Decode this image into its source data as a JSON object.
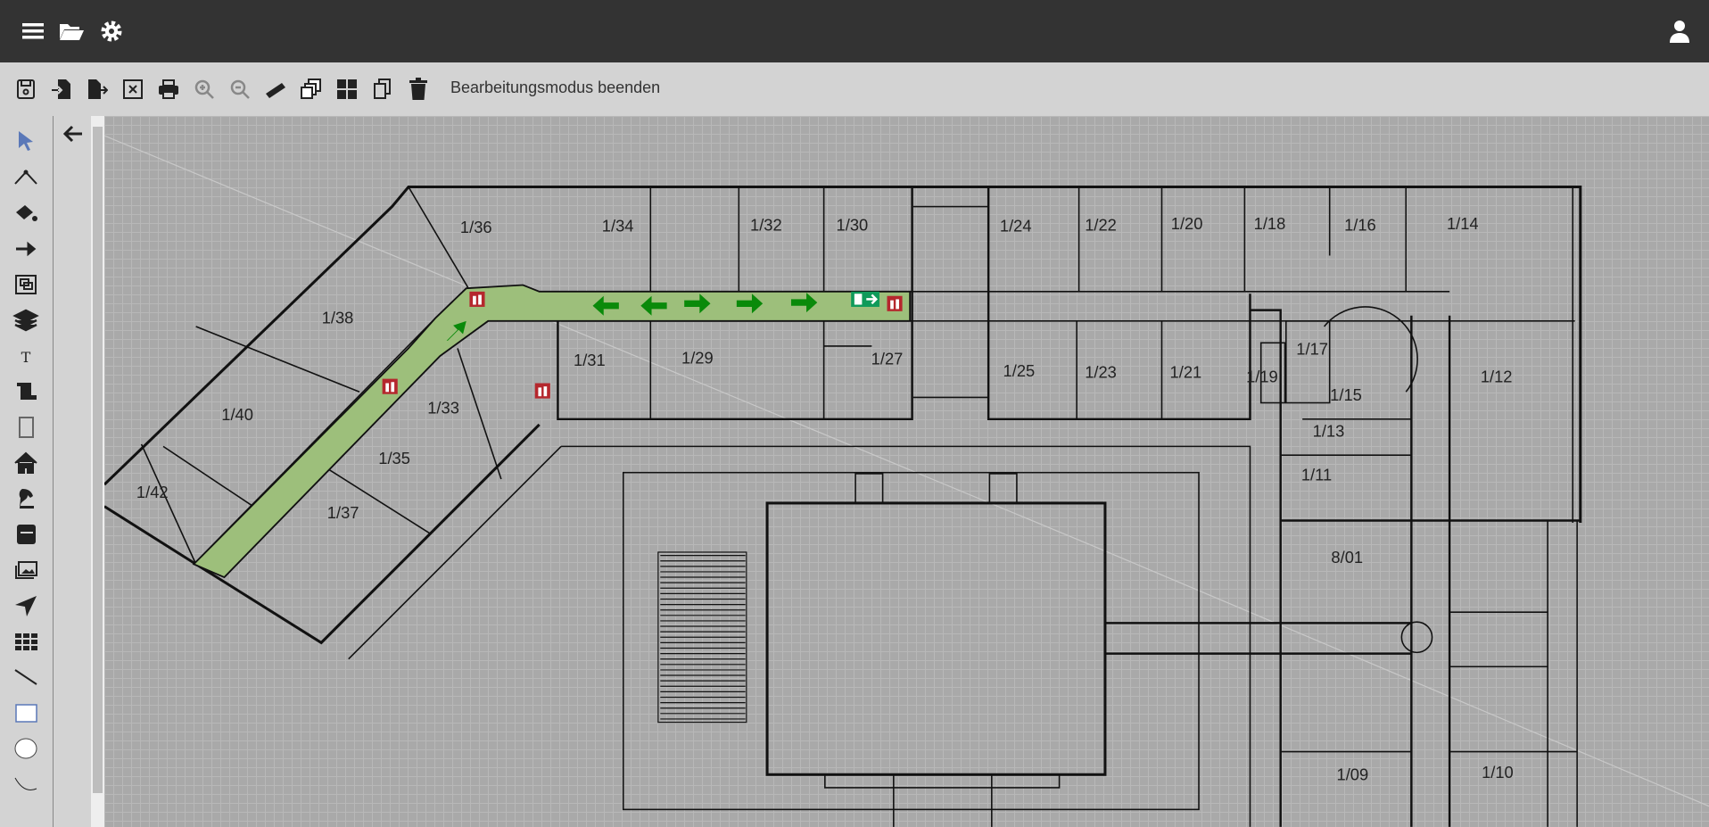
{
  "topbar": {
    "icons": [
      "menu-icon",
      "folder-open-icon",
      "gear-icon",
      "user-icon"
    ]
  },
  "toolbar": {
    "icons": [
      "save-icon",
      "import-icon",
      "export-icon",
      "close-file-icon",
      "print-icon",
      "zoom-in-icon",
      "zoom-out-icon",
      "ruler-icon",
      "clone-icon",
      "grid-icon",
      "copy-icon",
      "trash-icon"
    ],
    "exit_edit_label": "Bearbeitungsmodus beenden"
  },
  "tools": [
    "pointer-icon",
    "polyline-icon",
    "fill-icon",
    "arrow-icon",
    "group-icon",
    "layers-icon",
    "text-icon",
    "scroll-icon",
    "rectangle-outline-icon",
    "home-icon",
    "chess-knight-icon",
    "book-icon",
    "images-icon",
    "location-arrow-icon",
    "table-icon",
    "line-icon",
    "rectangle-icon",
    "circle-icon",
    "arc-icon"
  ],
  "panel": {
    "back_icon": "arrow-left-icon"
  },
  "colors": {
    "escape_route": "#9dbf7b",
    "arrow": "#0a8a0a",
    "exit_sign": "#0f9a5a",
    "extinguisher": "#b5272d",
    "active_tool": "#5a78b8"
  },
  "rooms": [
    "1/36",
    "1/34",
    "1/32",
    "1/30",
    "1/24",
    "1/22",
    "1/20",
    "1/18",
    "1/16",
    "1/14",
    "1/38",
    "1/31",
    "1/29",
    "1/27",
    "1/25",
    "1/23",
    "1/21",
    "1/19",
    "1/17",
    "1/15",
    "1/12",
    "1/40",
    "1/33",
    "1/35",
    "1/13",
    "1/11",
    "1/42",
    "1/37",
    "8/01",
    "1/09",
    "1/10"
  ]
}
